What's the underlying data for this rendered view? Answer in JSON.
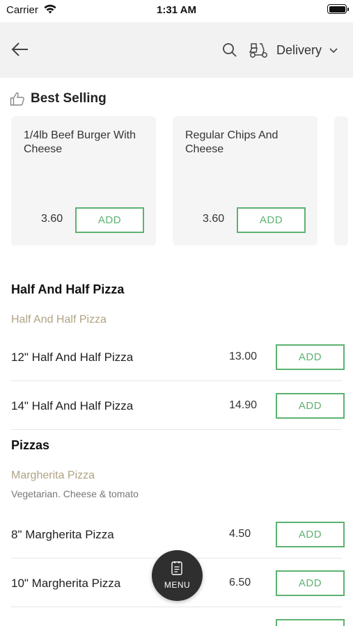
{
  "status_bar": {
    "carrier": "Carrier",
    "time": "1:31 AM"
  },
  "header": {
    "delivery_label": "Delivery",
    "icons": [
      "back-arrow-icon",
      "search-icon",
      "scooter-icon",
      "chevron-down-icon"
    ]
  },
  "best_selling": {
    "title": "Best Selling",
    "items": [
      {
        "name": "1/4lb Beef Burger With Cheese",
        "price": "3.60",
        "add_label": "ADD"
      },
      {
        "name": "Regular Chips And Cheese",
        "price": "3.60",
        "add_label": "ADD"
      }
    ]
  },
  "sections": [
    {
      "title": "Half And Half Pizza",
      "subcategory": "Half And Half Pizza",
      "items": [
        {
          "name": "12\" Half And Half Pizza",
          "price": "13.00",
          "add_label": "ADD"
        },
        {
          "name": "14\" Half And Half Pizza",
          "price": "14.90",
          "add_label": "ADD"
        }
      ]
    },
    {
      "title": "Pizzas",
      "subcategory": "Margherita Pizza",
      "description": "Vegetarian. Cheese & tomato",
      "items": [
        {
          "name": "8\" Margherita Pizza",
          "price": "4.50",
          "add_label": "ADD"
        },
        {
          "name": "10\" Margherita Pizza",
          "price": "6.50",
          "add_label": "ADD"
        }
      ]
    }
  ],
  "menu_button": {
    "label": "MENU"
  },
  "colors": {
    "accent_green": "#5cb270",
    "subcategory_tan": "#b0a384",
    "header_bg": "#f2f2f2",
    "fab_bg": "#2f2f2f"
  }
}
